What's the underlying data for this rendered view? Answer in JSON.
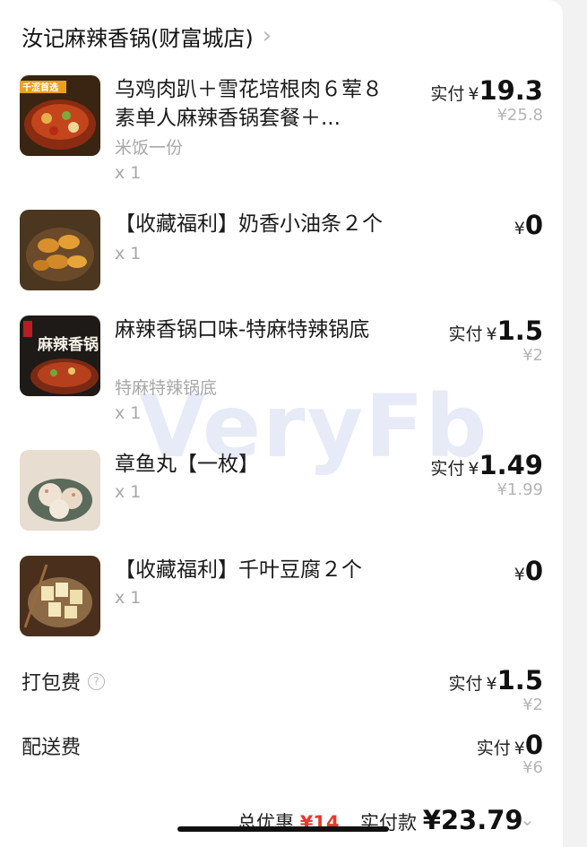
{
  "shop": {
    "name": "汝记麻辣香锅(财富城店)"
  },
  "paid_label": "实付",
  "currency": "¥",
  "items": [
    {
      "name": "乌鸡肉趴＋雪花培根肉６荤８素单人麻辣香锅套餐＋...",
      "sub": "米饭一份",
      "qty": "x 1",
      "paid": "19.3",
      "orig": "¥25.8",
      "badge": "千涩首选"
    },
    {
      "name": "【收藏福利】奶香小油条２个",
      "sub": "",
      "qty": "x 1",
      "paid": "0",
      "orig": ""
    },
    {
      "name": "麻辣香锅口味-特麻特辣锅底",
      "sub": "特麻特辣锅底",
      "qty": "x 1",
      "paid": "1.5",
      "orig": "¥2",
      "badge": "麻辣香锅"
    },
    {
      "name": "章鱼丸【一枚】",
      "sub": "",
      "qty": "x 1",
      "paid": "1.49",
      "orig": "¥1.99"
    },
    {
      "name": "【收藏福利】千叶豆腐２个",
      "sub": "",
      "qty": "x 1",
      "paid": "0",
      "orig": ""
    }
  ],
  "fees": [
    {
      "label": "打包费",
      "paid": "1.5",
      "orig": "¥2"
    },
    {
      "label": "配送费",
      "paid": "0",
      "orig": "¥6"
    }
  ],
  "watermark": "VeryFb",
  "footer": {
    "discount_label": "总优惠",
    "discount_value": "¥14",
    "pay_label": "实付款",
    "pay_value": "¥23.79"
  }
}
